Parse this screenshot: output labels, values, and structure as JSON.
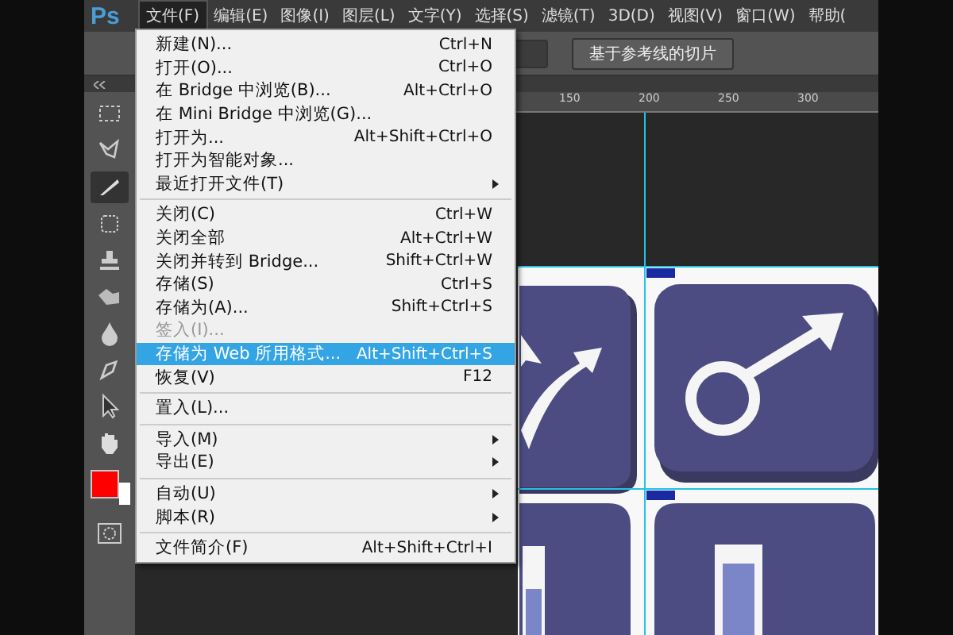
{
  "app": {
    "logo": "Ps"
  },
  "menubar": [
    {
      "label": "文件(F)",
      "selected": true
    },
    {
      "label": "编辑(E)",
      "selected": false
    },
    {
      "label": "图像(I)",
      "selected": false
    },
    {
      "label": "图层(L)",
      "selected": false
    },
    {
      "label": "文字(Y)",
      "selected": false
    },
    {
      "label": "选择(S)",
      "selected": false
    },
    {
      "label": "滤镜(T)",
      "selected": false
    },
    {
      "label": "3D(D)",
      "selected": false
    },
    {
      "label": "视图(V)",
      "selected": false
    },
    {
      "label": "窗口(W)",
      "selected": false
    },
    {
      "label": "帮助(",
      "selected": false
    }
  ],
  "options_bar": {
    "button": "基于参考线的切片"
  },
  "file_menu": [
    {
      "kind": "item",
      "label": "新建(N)...",
      "shortcut": "Ctrl+N",
      "submenu": false,
      "disabled": false,
      "selected": false
    },
    {
      "kind": "item",
      "label": "打开(O)...",
      "shortcut": "Ctrl+O",
      "submenu": false,
      "disabled": false,
      "selected": false
    },
    {
      "kind": "item",
      "label": "在 Bridge 中浏览(B)...",
      "shortcut": "Alt+Ctrl+O",
      "submenu": false,
      "disabled": false,
      "selected": false
    },
    {
      "kind": "item",
      "label": "在 Mini Bridge 中浏览(G)...",
      "submenu": false,
      "disabled": false,
      "selected": false
    },
    {
      "kind": "item",
      "label": "打开为...",
      "shortcut": "Alt+Shift+Ctrl+O",
      "submenu": false,
      "disabled": false,
      "selected": false
    },
    {
      "kind": "item",
      "label": "打开为智能对象...",
      "submenu": false,
      "disabled": false,
      "selected": false
    },
    {
      "kind": "item",
      "label": "最近打开文件(T)",
      "submenu": true,
      "disabled": false,
      "selected": false
    },
    {
      "kind": "separator"
    },
    {
      "kind": "item",
      "label": "关闭(C)",
      "shortcut": "Ctrl+W",
      "submenu": false,
      "disabled": false,
      "selected": false
    },
    {
      "kind": "item",
      "label": "关闭全部",
      "shortcut": "Alt+Ctrl+W",
      "submenu": false,
      "disabled": false,
      "selected": false
    },
    {
      "kind": "item",
      "label": "关闭并转到 Bridge...",
      "shortcut": "Shift+Ctrl+W",
      "submenu": false,
      "disabled": false,
      "selected": false
    },
    {
      "kind": "item",
      "label": "存储(S)",
      "shortcut": "Ctrl+S",
      "submenu": false,
      "disabled": false,
      "selected": false
    },
    {
      "kind": "item",
      "label": "存储为(A)...",
      "shortcut": "Shift+Ctrl+S",
      "submenu": false,
      "disabled": false,
      "selected": false
    },
    {
      "kind": "item",
      "label": "签入(I)...",
      "submenu": false,
      "disabled": true,
      "selected": false
    },
    {
      "kind": "item",
      "label": "存储为 Web 所用格式...",
      "shortcut": "Alt+Shift+Ctrl+S",
      "submenu": false,
      "disabled": false,
      "selected": true
    },
    {
      "kind": "item",
      "label": "恢复(V)",
      "shortcut": "F12",
      "submenu": false,
      "disabled": false,
      "selected": false
    },
    {
      "kind": "separator"
    },
    {
      "kind": "item",
      "label": "置入(L)...",
      "submenu": false,
      "disabled": false,
      "selected": false
    },
    {
      "kind": "separator"
    },
    {
      "kind": "item",
      "label": "导入(M)",
      "submenu": true,
      "disabled": false,
      "selected": false
    },
    {
      "kind": "item",
      "label": "导出(E)",
      "submenu": true,
      "disabled": false,
      "selected": false
    },
    {
      "kind": "separator"
    },
    {
      "kind": "item",
      "label": "自动(U)",
      "submenu": true,
      "disabled": false,
      "selected": false
    },
    {
      "kind": "item",
      "label": "脚本(R)",
      "submenu": true,
      "disabled": false,
      "selected": false
    },
    {
      "kind": "separator"
    },
    {
      "kind": "item",
      "label": "文件简介(F)",
      "shortcut": "Alt+Shift+Ctrl+I",
      "submenu": false,
      "disabled": false,
      "selected": false
    }
  ],
  "toolbar": {
    "tools": [
      {
        "kind": "marquee",
        "selected": false
      },
      {
        "kind": "lasso",
        "selected": false
      },
      {
        "kind": "slice",
        "selected": true
      },
      {
        "kind": "brush",
        "selected": false
      },
      {
        "kind": "stamp",
        "selected": false
      },
      {
        "kind": "eraser",
        "selected": false
      },
      {
        "kind": "drop",
        "selected": false
      },
      {
        "kind": "pen",
        "selected": false
      },
      {
        "kind": "pointer",
        "selected": false
      },
      {
        "kind": "hand",
        "selected": false
      }
    ],
    "foreground": {
      "color": "#ff0000"
    },
    "background": {
      "color": "#ffffff"
    }
  },
  "ruler": {
    "labels": [
      "150",
      "200",
      "250",
      "300"
    ]
  }
}
